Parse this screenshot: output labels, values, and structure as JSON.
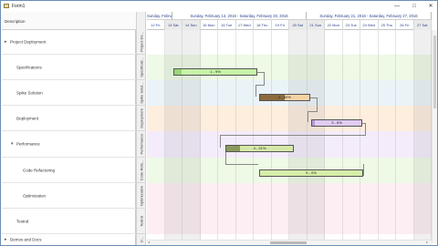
{
  "window": {
    "title": "Form1",
    "minimize": "—",
    "maximize": "□",
    "close": "✕"
  },
  "grid": {
    "column_header": "Description",
    "tasks": [
      {
        "name": "Project Deployment",
        "expander": "▸"
      },
      {
        "name": "Specifications"
      },
      {
        "name": "Spike Solution"
      },
      {
        "name": "Deployment"
      },
      {
        "name": "Performance",
        "expander": "▾"
      },
      {
        "name": "Code Refactoring"
      },
      {
        "name": "Optimization"
      },
      {
        "name": "Testnd"
      },
      {
        "name": "Demos and Docs",
        "expander": "▸"
      }
    ]
  },
  "resources": [
    "Project De...",
    "Specificati...",
    "Spike Solut...",
    "Deployment",
    "Performance",
    "Code Refa...",
    "Optimization",
    "Testnd",
    "D..."
  ],
  "timeline": {
    "weeks": [
      "Sunday, Februar...",
      "Sunday, February 14, 2016 - Saturday, February 20, 2016",
      "Sunday, February 21, 2016 - Saturday, February 27, 2016"
    ],
    "days": [
      "12 Fri",
      "13 Sat",
      "14 Sun",
      "15 Mon",
      "16 Tue",
      "17 Wed",
      "18 Thu",
      "19 Fri",
      "20 Sat",
      "21 Sun",
      "22 Mon",
      "23 Tue",
      "24 Wed",
      "25 Thu",
      "26 Fri",
      "27 Sat"
    ],
    "weekend_days": [
      "13 Sat",
      "14 Sun",
      "20 Sat",
      "21 Sun",
      "27 Sat"
    ]
  },
  "bars": [
    {
      "label": "1 - 9%",
      "row": "Specifications",
      "percent_complete": 9,
      "color": "#c6f2a8",
      "done_color": "#9ad47a"
    },
    {
      "label": "2 - 50%",
      "row": "Spike Solution",
      "percent_complete": 50,
      "color": "#f6d3a4",
      "done_color": "#8c6b3c"
    },
    {
      "label": "3 - 6%",
      "row": "Deployment",
      "percent_complete": 6,
      "color": "#e1ccf2",
      "done_color": "#b89ad6"
    },
    {
      "label": "4 - 21%",
      "row": "Performance",
      "percent_complete": 21,
      "color": "#d6e8a8",
      "done_color": "#8a9a5c"
    },
    {
      "label": "5 - 0%",
      "row": "Code Refactoring",
      "percent_complete": 0,
      "color": "#d6eea8",
      "done_color": "#a0c070"
    }
  ],
  "colors": {
    "band_specifications": "#eef9e6",
    "band_spike": "#eaf4f8",
    "band_deployment": "#fdeede",
    "band_performance": "#f4ecfb",
    "band_code": "#eef9e6",
    "band_optimization": "#fdeef4",
    "band_testnd": "#fdeef4",
    "header_text": "#2b3c8a"
  }
}
